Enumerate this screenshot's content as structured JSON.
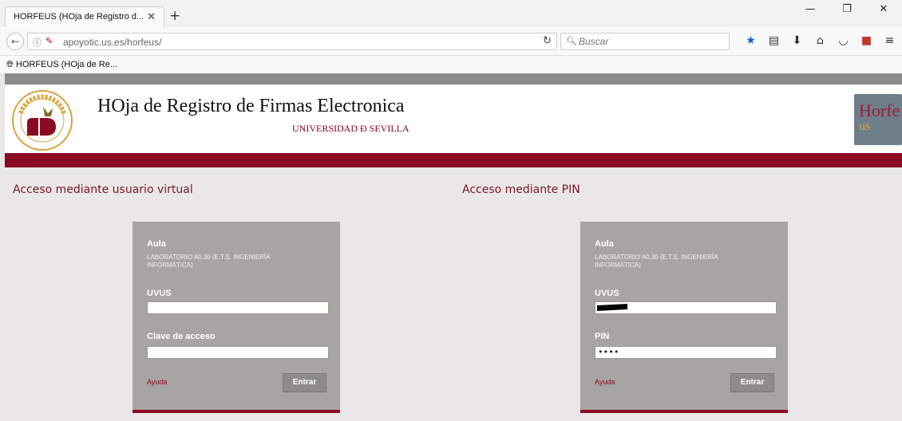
{
  "browser": {
    "tab_title": "HORFEUS (HOja de Registro d...",
    "tab_close": "✕",
    "new_tab": "+",
    "url": "apoyotic.us.es/horfeus/",
    "search_placeholder": "Buscar",
    "bookmark": "HORFEUS (HOja de Re...",
    "window_controls": [
      "—",
      "❐",
      "✕"
    ],
    "toolbar_icons": [
      "star-icon",
      "reading-list-icon",
      "download-icon",
      "home-icon",
      "pocket-icon",
      "addon-icon",
      "menu-icon"
    ]
  },
  "header": {
    "title": "HOja de Registro de Firmas Electronica",
    "subtitle": "UNIVERSIDAD Ð SEVILLA",
    "logo_text_1": "Horfe",
    "logo_text_2": "us"
  },
  "colors": {
    "brand_red": "#8a0a23",
    "box_gray": "#a7a5a2",
    "page_bg": "#e9e8e6"
  },
  "virtual": {
    "section_title": "Acceso mediante usuario virtual",
    "aula_label": "Aula",
    "aula_value": "LABORATORIO A0.30 (E.T.S. INGENIERÍA INFORMÁTICA)",
    "user_label": "UVUS",
    "user_value": "",
    "pass_label": "Clave de acceso",
    "pass_value": "",
    "help": "Ayuda",
    "submit": "Entrar"
  },
  "pin": {
    "section_title": "Acceso mediante PIN",
    "aula_label": "Aula",
    "aula_value": "LABORATORIO A0.30 (E.T.S. INGENIERÍA INFORMÁTICA)",
    "user_label": "UVUS",
    "pin_label": "PIN",
    "pin_value": "••••",
    "help": "Ayuda",
    "submit": "Entrar"
  }
}
